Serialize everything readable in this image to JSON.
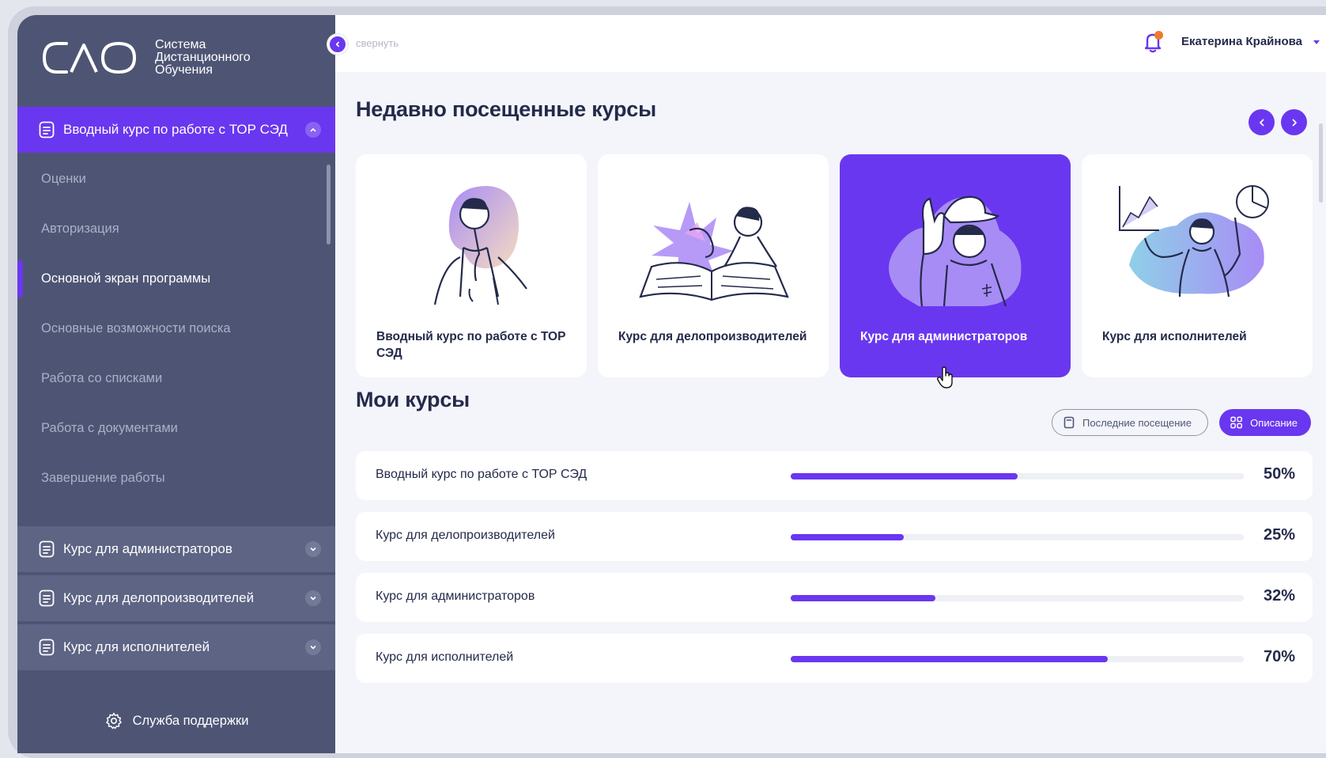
{
  "brand": {
    "logo_text": "СДО",
    "title_lines": [
      "Система",
      "Дистанционного",
      "Обучения"
    ]
  },
  "colors": {
    "accent": "#6a37f0",
    "sidebar": "#4e5574",
    "notification": "#f07a2a"
  },
  "sidebar": {
    "active_course": "Вводный курс по работе с ТОР СЭД",
    "lessons": [
      "Оценки",
      "Авторизация",
      "Основной экран программы",
      "Основные возможности поиска",
      "Работа со списками",
      "Работа с документами",
      "Завершение работы"
    ],
    "current_lesson": "Основной экран программы",
    "other_courses": [
      "Курс для администраторов",
      "Курс для делопроизводителей",
      "Курс для исполнителей"
    ],
    "support_label": "Служба поддержки"
  },
  "topbar": {
    "collapse_label": "свернуть",
    "user_name": "Екатерина Крайнова",
    "icons": [
      "chevron-left-icon",
      "bell-icon",
      "caret-down-icon"
    ]
  },
  "recent": {
    "title": "Недавно посещенные курсы",
    "cards": [
      {
        "title": "Вводный курс по работе с ТОР СЭД",
        "highlighted": false
      },
      {
        "title": "Курс для делопроизводителей",
        "highlighted": false
      },
      {
        "title": "Курс для администраторов",
        "highlighted": true
      },
      {
        "title": "Курс для исполнителей",
        "highlighted": false
      }
    ]
  },
  "my_courses": {
    "title": "Мои курсы",
    "sort_last_visit": "Последние посещение",
    "sort_description": "Описание",
    "rows": [
      {
        "name": "Вводный курс по работе с ТОР СЭД",
        "progress": 50,
        "progress_label": "50%"
      },
      {
        "name": "Курс для делопроизводителей",
        "progress": 25,
        "progress_label": "25%"
      },
      {
        "name": "Курс для администраторов",
        "progress": 32,
        "progress_label": "32%"
      },
      {
        "name": "Курс для исполнителей",
        "progress": 70,
        "progress_label": "70%"
      }
    ]
  }
}
